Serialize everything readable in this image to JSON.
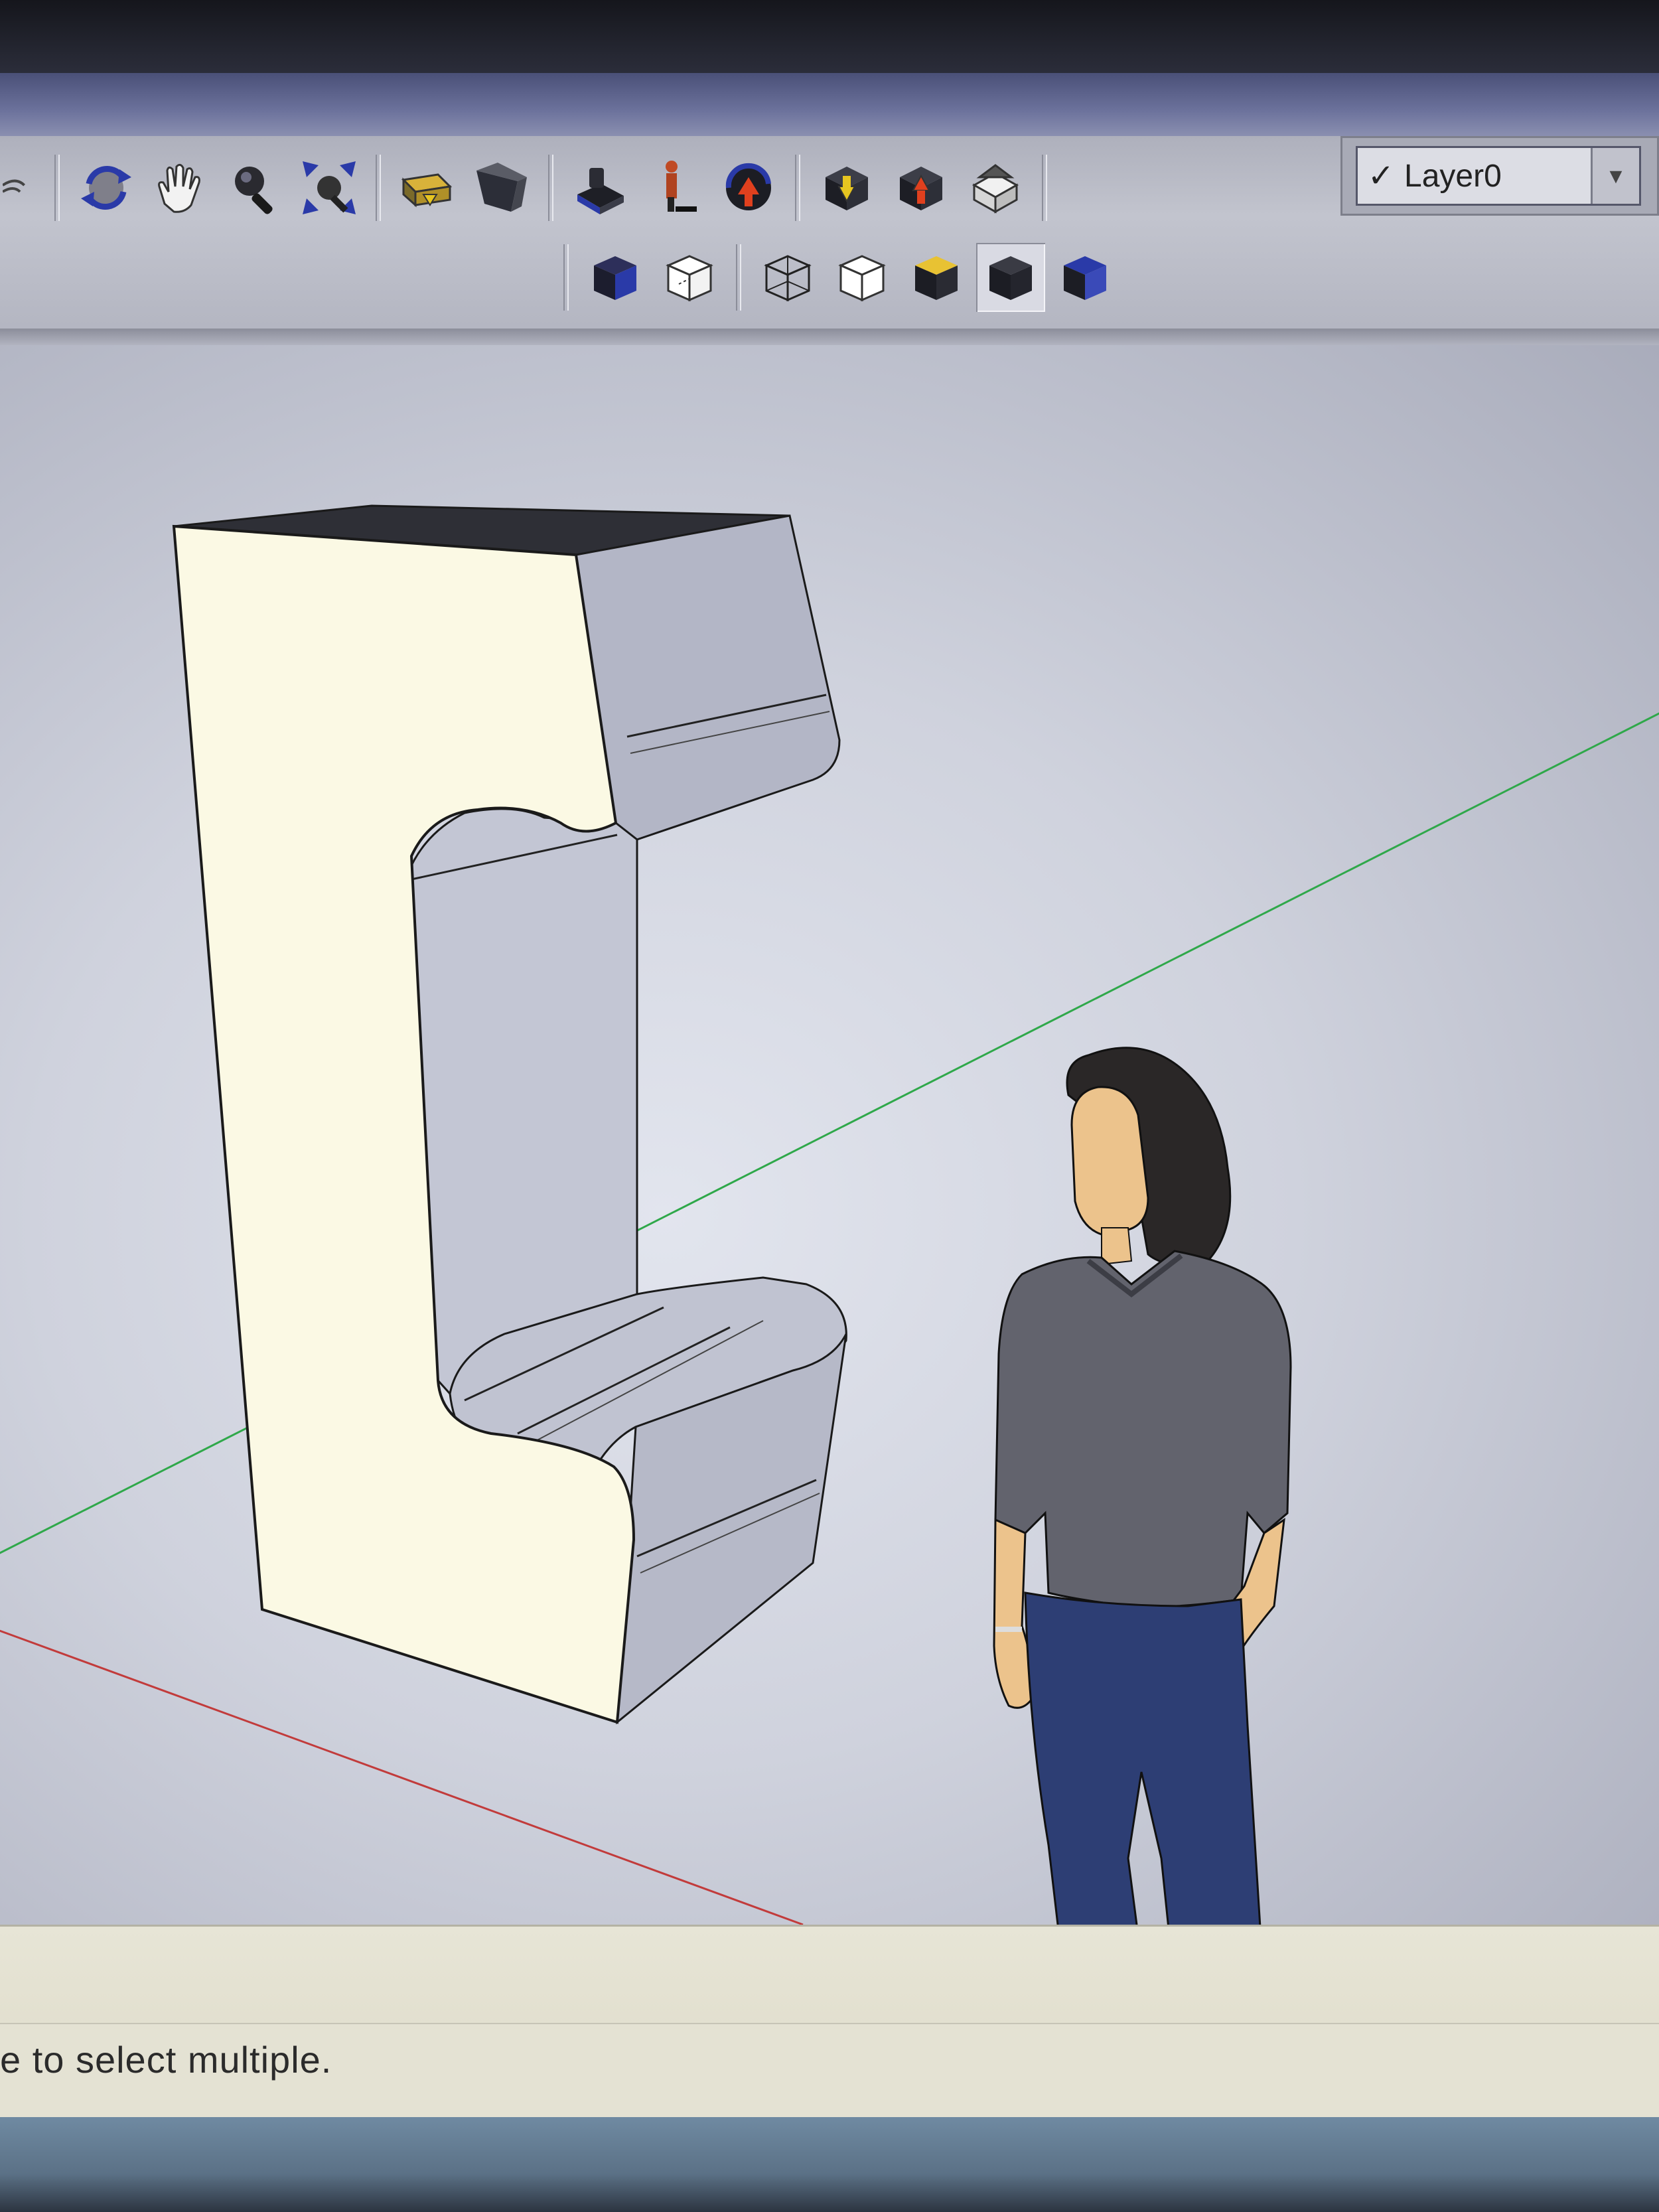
{
  "toolbar": {
    "camera_tools": [
      {
        "name": "orbit-icon"
      },
      {
        "name": "pan-hand-icon"
      },
      {
        "name": "zoom-icon"
      },
      {
        "name": "zoom-extents-icon"
      }
    ],
    "view_tools": [
      {
        "name": "previous-view-icon"
      },
      {
        "name": "next-view-icon"
      }
    ],
    "walk_tools": [
      {
        "name": "position-camera-icon"
      },
      {
        "name": "walk-icon"
      },
      {
        "name": "look-around-icon"
      }
    ],
    "warehouse_tools": [
      {
        "name": "get-models-icon"
      },
      {
        "name": "share-model-icon"
      },
      {
        "name": "share-component-icon"
      }
    ],
    "face_styles": [
      {
        "name": "xray-style-icon",
        "active": false
      },
      {
        "name": "back-edges-style-icon",
        "active": false
      },
      {
        "name": "wireframe-style-icon",
        "active": false
      },
      {
        "name": "hidden-line-style-icon",
        "active": false
      },
      {
        "name": "shaded-style-icon",
        "active": false
      },
      {
        "name": "shaded-with-textures-style-icon",
        "active": true
      },
      {
        "name": "monochrome-style-icon",
        "active": false
      }
    ]
  },
  "layers": {
    "current_layer": "Layer0",
    "checked": true,
    "check_icon": "checkmark-icon",
    "dropdown_icon": "dropdown-arrow-icon"
  },
  "viewport": {
    "axis_colors": {
      "green": "#2fa84a",
      "red": "#c23b3b"
    },
    "model_face_color": "#fbf9e4",
    "model_side_color": "#b6b9c8"
  },
  "status": {
    "hint_text": "e to select multiple."
  }
}
